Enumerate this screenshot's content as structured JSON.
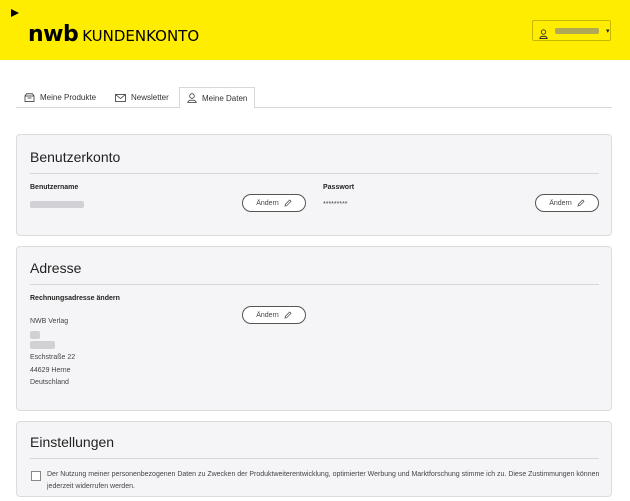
{
  "header": {
    "logo_brand": "nwb",
    "logo_suffix": "KUNDENKONTO",
    "account_menu_caret": "▾"
  },
  "tabs": [
    {
      "label": "Meine Produkte",
      "icon": "box-icon",
      "active": false
    },
    {
      "label": "Newsletter",
      "icon": "envelope-icon",
      "active": false
    },
    {
      "label": "Meine Daten",
      "icon": "user-icon",
      "active": true
    }
  ],
  "benutzerkonto": {
    "title": "Benutzerkonto",
    "username_label": "Benutzername",
    "password_label": "Passwort",
    "password_value": "*********",
    "change_label": "Ändern"
  },
  "adresse": {
    "title": "Adresse",
    "billing_label": "Rechnungsadresse ändern",
    "company": "NWB Verlag",
    "street": "Eschstraße 22",
    "city": "44629 Herne",
    "country": "Deutschland",
    "change_label": "Ändern"
  },
  "einstellungen": {
    "title": "Einstellungen",
    "consent_text": "Der Nutzung meiner personenbezogenen Daten zu Zwecken der Produktweiterentwicklung, optimierter Werbung und Marktforschung stimme ich zu. Diese Zustimmungen können jederzeit widerrufen werden.",
    "consent_checked": false
  },
  "colors": {
    "brand_yellow": "#ffed00",
    "card_bg": "#f5f5f7"
  }
}
